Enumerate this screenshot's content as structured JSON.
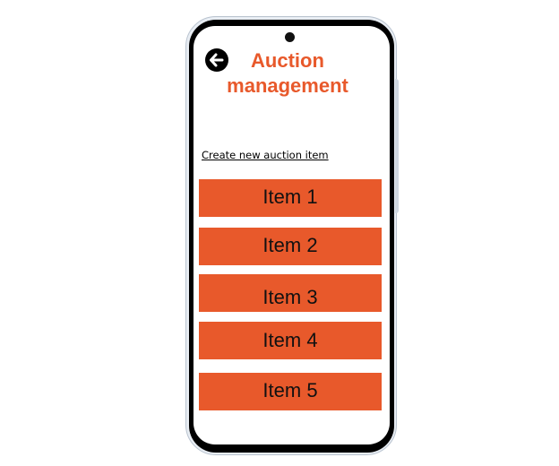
{
  "header": {
    "back_icon": "back-arrow-icon",
    "title_line1": "Auction",
    "title_line2": "management"
  },
  "actions": {
    "create_link": "Create new auction item"
  },
  "items": [
    {
      "label": "Item 1"
    },
    {
      "label": "Item 2"
    },
    {
      "label": "Item 3"
    },
    {
      "label": "Item 4"
    },
    {
      "label": "Item 5"
    }
  ],
  "colors": {
    "accent": "#e8592b",
    "text": "#111111",
    "bezel": "#000000",
    "frame": "#e8edf3"
  }
}
